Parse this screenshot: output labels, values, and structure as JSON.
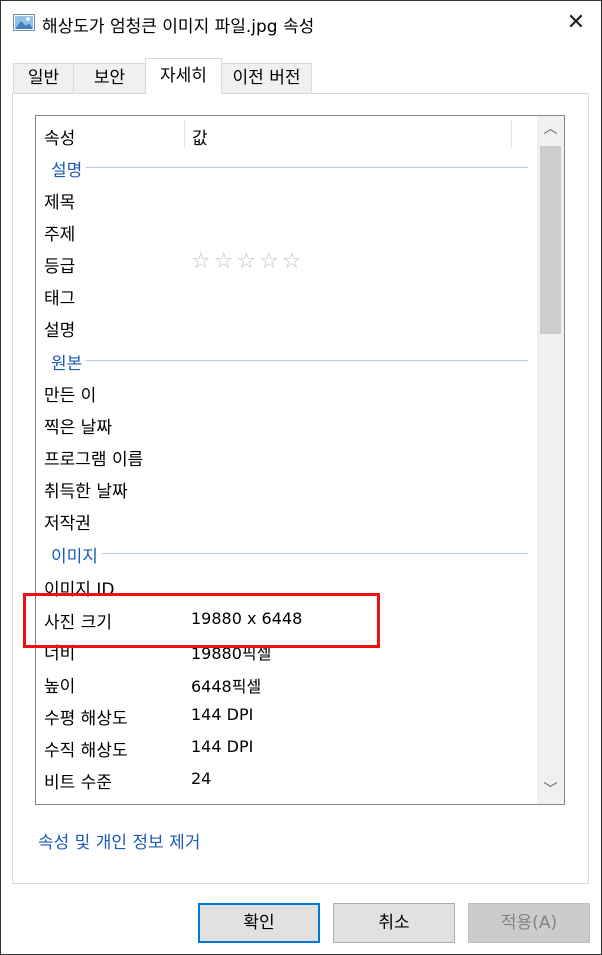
{
  "window": {
    "title": "해상도가 엄청큰 이미지 파일.jpg 속성",
    "close_label": "✕",
    "icon": "image-file-icon"
  },
  "tabs": [
    {
      "label": "일반"
    },
    {
      "label": "보안"
    },
    {
      "label": "자세히",
      "active": true
    },
    {
      "label": "이전 버전"
    }
  ],
  "details": {
    "header": {
      "property": "속성",
      "value": "값"
    },
    "groups": {
      "description": "설명",
      "origin": "원본",
      "image": "이미지"
    },
    "rows": {
      "title": {
        "label": "제목",
        "value": ""
      },
      "subject": {
        "label": "주제",
        "value": ""
      },
      "rating": {
        "label": "등급",
        "value": "☆☆☆☆☆",
        "stars_filled": 0,
        "stars_total": 5
      },
      "tags": {
        "label": "태그",
        "value": ""
      },
      "comments": {
        "label": "설명",
        "value": ""
      },
      "authors": {
        "label": "만든 이",
        "value": ""
      },
      "date_taken": {
        "label": "찍은 날짜",
        "value": ""
      },
      "program_name": {
        "label": "프로그램 이름",
        "value": ""
      },
      "date_acquired": {
        "label": "취득한 날짜",
        "value": ""
      },
      "copyright": {
        "label": "저작권",
        "value": ""
      },
      "image_id": {
        "label": "이미지 ID",
        "value": ""
      },
      "dimensions": {
        "label": "사진 크기",
        "value": "19880 x 6448"
      },
      "width": {
        "label": "너비",
        "value": "19880픽셀"
      },
      "height": {
        "label": "높이",
        "value": "6448픽셀"
      },
      "horizontal_resolution": {
        "label": "수평 해상도",
        "value": "144 DPI"
      },
      "vertical_resolution": {
        "label": "수직 해상도",
        "value": "144 DPI"
      },
      "bit_depth": {
        "label": "비트 수준",
        "value": "24"
      }
    },
    "scroll": {
      "up_arrow": "︿",
      "down_arrow": "﹀"
    }
  },
  "remove_properties_link": "속성 및 개인 정보 제거",
  "buttons": {
    "ok": "확인",
    "cancel": "취소",
    "apply": "적용(A)"
  },
  "colors": {
    "highlight": "#e11111",
    "link": "#1c5ab8",
    "group_label": "#1c5ab8",
    "default_button_border": "#0078d7"
  }
}
